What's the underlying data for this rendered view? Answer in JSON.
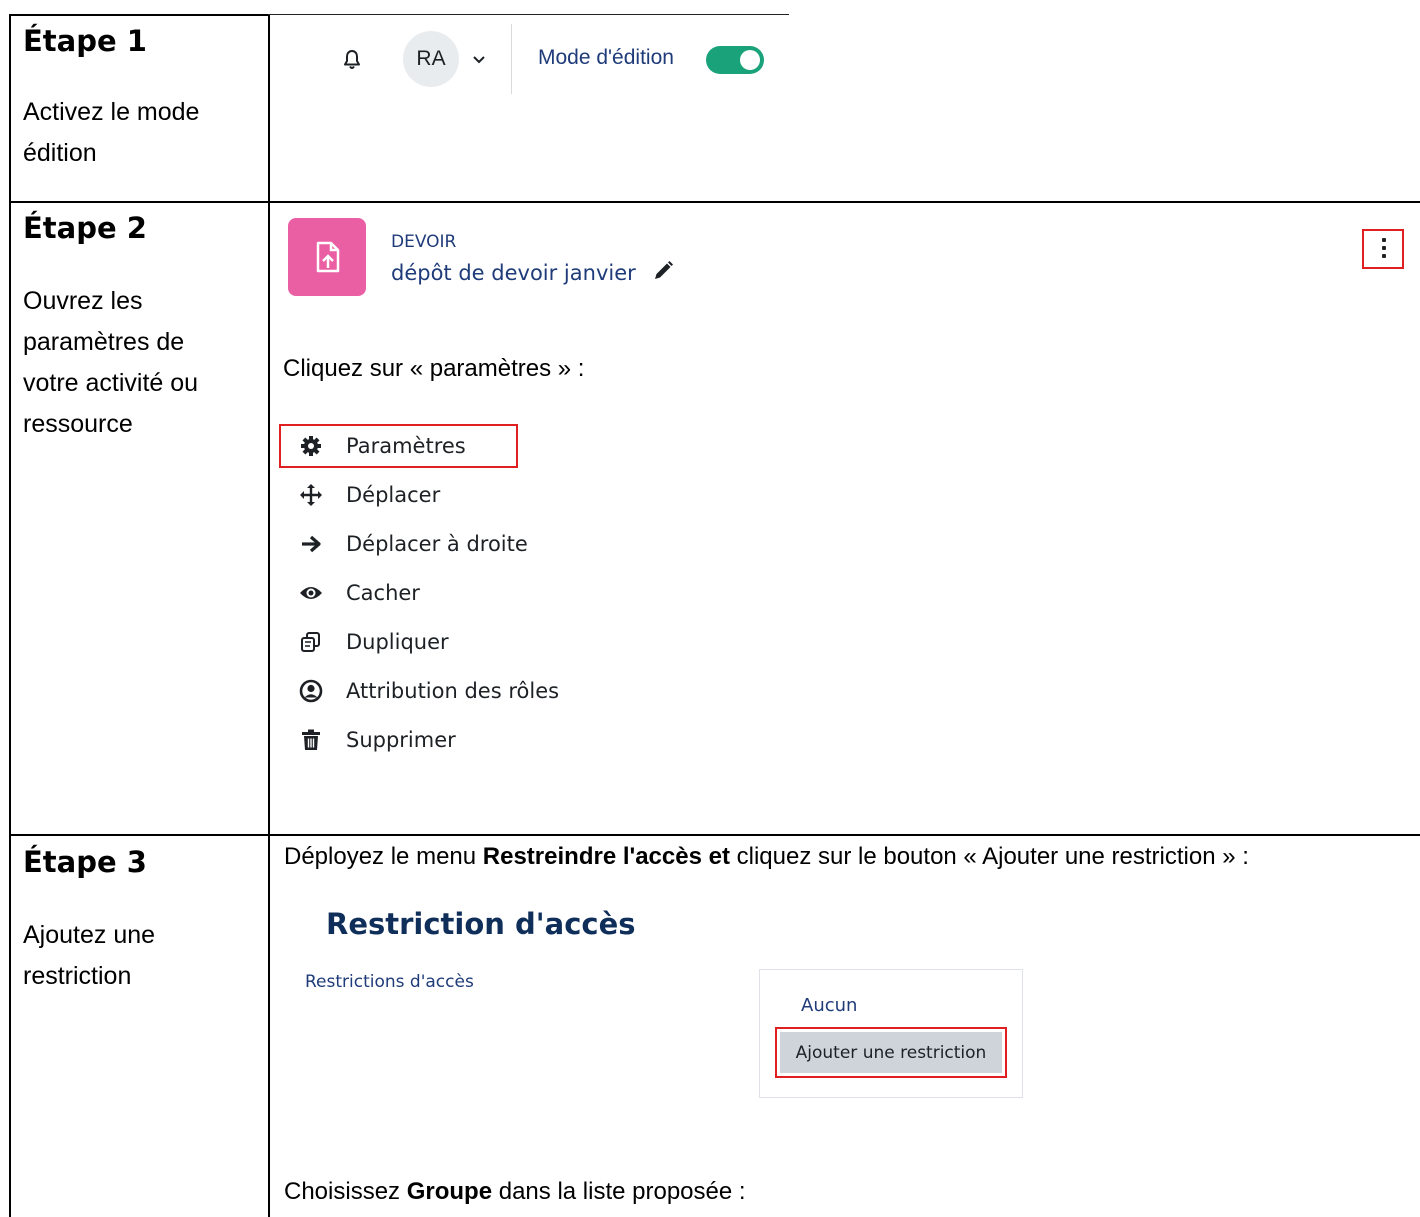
{
  "steps": [
    {
      "title": "Étape 1",
      "description_lines": [
        "Activez le mode",
        "édition"
      ]
    },
    {
      "title": "Étape 2",
      "description_lines": [
        "Ouvrez les",
        "paramètres de",
        "votre activité ou",
        "ressource"
      ]
    },
    {
      "title": "Étape 3",
      "description_lines": [
        "Ajoutez une",
        "restriction"
      ]
    }
  ],
  "step1_ui": {
    "avatar_initials": "RA",
    "edit_mode_label": "Mode d'édition",
    "edit_mode_on": true,
    "icons": [
      "bell-icon",
      "chevron-down-icon"
    ]
  },
  "step2_ui": {
    "activity_type": "DEVOIR",
    "activity_name": "dépôt de devoir janvier",
    "instruction": "Cliquez sur « paramètres » :",
    "menu_items": [
      {
        "label": "Paramètres",
        "icon": "gear-icon",
        "highlighted": true
      },
      {
        "label": "Déplacer",
        "icon": "move-arrows-icon"
      },
      {
        "label": "Déplacer à droite",
        "icon": "arrow-right-icon"
      },
      {
        "label": "Cacher",
        "icon": "eye-icon"
      },
      {
        "label": "Dupliquer",
        "icon": "duplicate-icon"
      },
      {
        "label": "Attribution des rôles",
        "icon": "user-circle-icon"
      },
      {
        "label": "Supprimer",
        "icon": "trash-icon"
      }
    ]
  },
  "step3_ui": {
    "instruction_prefix": "Déployez le menu ",
    "instruction_bold": "Restreindre l'accès et",
    "instruction_suffix": " cliquez sur le bouton « Ajouter une restriction » :",
    "heading": "Restriction d'accès",
    "field_label": "Restrictions d'accès",
    "current_value": "Aucun",
    "add_button_label": "Ajouter une restriction",
    "choose_prefix": "Choisissez ",
    "choose_bold": "Groupe",
    "choose_suffix": " dans la liste proposée :"
  },
  "colors": {
    "link_blue": "#1f3b7a",
    "heading_navy": "#0f2f5a",
    "toggle_green": "#1aa37a",
    "activity_pink": "#ea5fa3",
    "highlight_red": "#e02020"
  }
}
